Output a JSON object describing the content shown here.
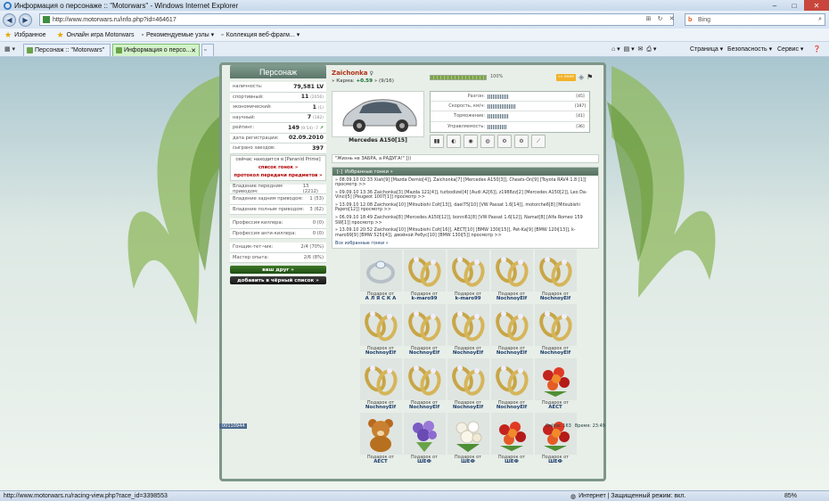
{
  "window": {
    "title": "Информация о персонаже :: \"Motorwars\" - Windows Internet Explorer"
  },
  "browser": {
    "url": "http://www.motorwars.ru/info.php?id=464617",
    "search_placeholder": "Bing",
    "favorites": {
      "label": "Избранное",
      "items": [
        "Онлайн игра Motorwars",
        "Рекомендуемые узлы ▾",
        "Коллекция веб-фрагм... ▾"
      ]
    },
    "tabs": [
      "Персонаж :: \"Motorwars\"",
      "Информация о персо..."
    ],
    "commands": [
      "Страница ▾",
      "Безопасность ▾",
      "Сервис ▾"
    ],
    "status_url": "http://www.motorwars.ru/racing-view.php?race_id=3398553",
    "zone": "Интернет | Защищенный режим: вкл.",
    "zoom": "85%"
  },
  "left": {
    "heading": "Персонаж",
    "stats": [
      {
        "label": "наличность:",
        "value": "79,581 LV",
        "extra": ""
      },
      {
        "label": "спортивный:",
        "value": "11",
        "extra": "(2056)"
      },
      {
        "label": "экономический:",
        "value": "1",
        "extra": "(1)"
      },
      {
        "label": "научный:",
        "value": "7",
        "extra": "(182)"
      },
      {
        "label": "рейтинг:",
        "value": "149",
        "extra": "(9.54) -7"
      },
      {
        "label": "дата регистрации:",
        "value": "02.09.2010",
        "extra": ""
      },
      {
        "label": "сыграно заездов:",
        "value": "397",
        "extra": ""
      }
    ],
    "location": "сейчас находится в [Paranid Prime]",
    "list_link": "список гонок »",
    "protocol_link": "протокол передачи предметов »",
    "skills": [
      {
        "label": "Владение передним приводом:",
        "value": "13 (2212)"
      },
      {
        "label": "Владение задним приводом:",
        "value": "1 (53)"
      },
      {
        "label": "Владение полным приводом:",
        "value": "3 (62)"
      }
    ],
    "profs": [
      {
        "label": "Профессия киллера:",
        "value": "0 (0)"
      },
      {
        "label": "Профессия анти-киллера:",
        "value": "0 (0)"
      }
    ],
    "extra": [
      {
        "label": "Гонщик-тет-чик:",
        "value": "2/4 (70%)"
      },
      {
        "label": "Мастер опыта:",
        "value": "2/6 (8%)"
      }
    ],
    "friend_button": "ваш друг »",
    "blacklist_button": "добавить в чёрный список »"
  },
  "right": {
    "nick": "Zaichonka",
    "karma_label": "» Карма:",
    "karma_value": "+0.59",
    "karma_extra": "» (9/16)",
    "car": "Mercedes A150[15]",
    "progress_label": "100%",
    "badge": "»» ееее",
    "specs": [
      {
        "label": "Разгон:",
        "value": "[45]",
        "fill": 0.23
      },
      {
        "label": "Скорость, км/ч:",
        "value": "[197]",
        "fill": 0.32
      },
      {
        "label": "Торможение:",
        "value": "[41]",
        "fill": 0.23
      },
      {
        "label": "Управляемость:",
        "value": "[36]",
        "fill": 0.21
      }
    ],
    "quote": "\"Жизнь не ЗАБРА, а РАДУГА!\" ]))",
    "races_title": "Избранные гонки »",
    "races": [
      "» 08.09.10 02:33 Xiah[9] [Mazda Demio[4]], Zaichonka[7] [Mercedes A150[3]], Cheats-On[9] [Toyota RAV4 1.8 [1]] просмотр >>",
      "» 09.09.10 13:36 Zaichonka[3] [Mazda 121[4]], turbodizel[4] [Audi A2[6]], z1988zz[2] [Mercedes A150[2]], Leo Da-Vinci[5] [Peugeot 1007[1]] просмотр >>",
      "» 13.09.10 12:08 Zaichonka[10] [Mitsubishi Colt[13]], dael75[10] [VW Passat 1.6[14]], motorche6[8] [Mitsubishi Pajero[12]] просмотр >>",
      "» 06.09.10 18:49 Zaichonka[8] [Mercedes A150[12]], bonni61[8] [VW Passat 1.6[12]], Namat[8] [Alfa Romeo 159 SW[1]] просмотр >>",
      "» 13.09.10 20:52 Zaichonka[10] [Mitsubishi Colt[16]], AECT[10] [BMW 130i[15]], Pet-Ka[9] [BMW 120i[13]], k-maro99[9] [BMW 525i[4]], двойной Ребус[10] [BMW 130i[5]] просмотр >>"
    ],
    "races_all": "Все избранные гонки »"
  },
  "gifts": {
    "caption": "Подарок от",
    "items": [
      {
        "from": "А Л Я С К А",
        "icon": "ring"
      },
      {
        "from": "k-maro99",
        "icon": "rings"
      },
      {
        "from": "k-maro99",
        "icon": "rings"
      },
      {
        "from": "NochnoyElf",
        "icon": "rings"
      },
      {
        "from": "NochnoyElf",
        "icon": "rings"
      },
      {
        "from": "NochnoyElf",
        "icon": "rings"
      },
      {
        "from": "NochnoyElf",
        "icon": "rings"
      },
      {
        "from": "NochnoyElf",
        "icon": "rings"
      },
      {
        "from": "NochnoyElf",
        "icon": "rings"
      },
      {
        "from": "NochnoyElf",
        "icon": "rings"
      },
      {
        "from": "NochnoyElf",
        "icon": "rings"
      },
      {
        "from": "NochnoyElf",
        "icon": "rings"
      },
      {
        "from": "NochnoyElf",
        "icon": "rings"
      },
      {
        "from": "NochnoyElf",
        "icon": "rings"
      },
      {
        "from": "AECT",
        "icon": "roses-red"
      },
      {
        "from": "AECT",
        "icon": "teddy"
      },
      {
        "from": "ШЕФ",
        "icon": "violets"
      },
      {
        "from": "ШЕФ",
        "icon": "roses-white"
      },
      {
        "from": "ШЕФ",
        "icon": "roses-red"
      },
      {
        "from": "ШЕФ",
        "icon": "roses-red"
      }
    ]
  },
  "footer": {
    "counter": "00110944",
    "online": "Online: 163",
    "time": "Время: 23:49"
  }
}
